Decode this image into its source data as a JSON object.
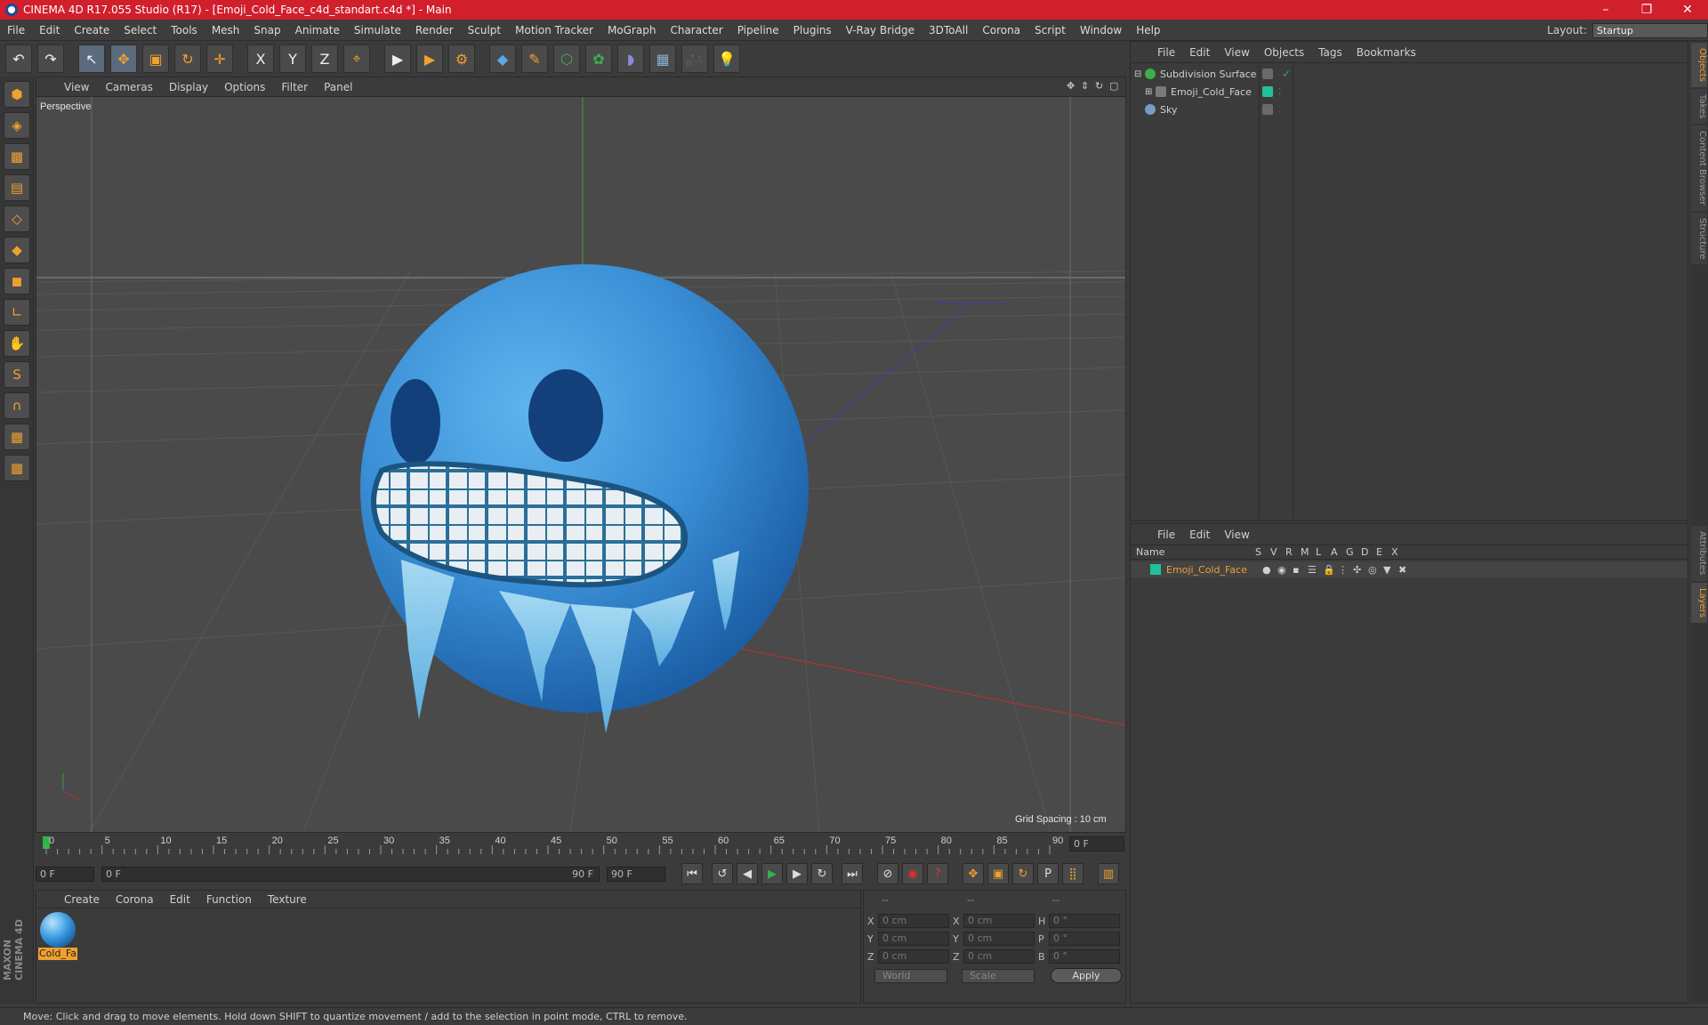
{
  "window": {
    "title": "CINEMA 4D R17.055 Studio (R17) - [Emoji_Cold_Face_c4d_standart.c4d *] - Main",
    "minimize": "–",
    "maximize": "❐",
    "close": "✕"
  },
  "menu": [
    "File",
    "Edit",
    "Create",
    "Select",
    "Tools",
    "Mesh",
    "Snap",
    "Animate",
    "Simulate",
    "Render",
    "Sculpt",
    "Motion Tracker",
    "MoGraph",
    "Character",
    "Pipeline",
    "Plugins",
    "V-Ray Bridge",
    "3DToAll",
    "Corona",
    "Script",
    "Window",
    "Help"
  ],
  "layout": {
    "label": "Layout:",
    "value": "Startup"
  },
  "toolbar": {
    "undo": "↶",
    "redo": "↷",
    "select": "↖",
    "move": "✥",
    "scale": "▣",
    "rotate": "↻",
    "transform": "✛",
    "x": "X",
    "y": "Y",
    "z": "Z",
    "coord": "⌖",
    "render": "▶",
    "render_view": "▶",
    "render_settings": "⚙",
    "cube": "◆",
    "pen": "✎",
    "subdiv": "⬡",
    "array": "✿",
    "deformer": "◗",
    "floor": "▦",
    "camera": "🎥",
    "light": "💡"
  },
  "viewport": {
    "menu": [
      "View",
      "Cameras",
      "Display",
      "Options",
      "Filter",
      "Panel"
    ],
    "label": "Perspective",
    "grid_spacing": "Grid Spacing : 10 cm"
  },
  "timeline": {
    "ticks": [
      "0",
      "5",
      "10",
      "15",
      "20",
      "25",
      "30",
      "35",
      "40",
      "45",
      "50",
      "55",
      "60",
      "65",
      "70",
      "75",
      "80",
      "85",
      "90"
    ],
    "current": "0 F",
    "start": "0 F",
    "range_start": "0 F",
    "range_end": "90 F",
    "end": "90 F"
  },
  "material_panel": {
    "menu": [
      "Create",
      "Corona",
      "Edit",
      "Function",
      "Texture"
    ],
    "material_name": "Cold_Fa"
  },
  "coords": {
    "header": [
      "--",
      "--",
      "--"
    ],
    "rows": [
      {
        "a1": "X",
        "v1": "0 cm",
        "a2": "X",
        "v2": "0 cm",
        "a3": "H",
        "v3": "0 °"
      },
      {
        "a1": "Y",
        "v1": "0 cm",
        "a2": "Y",
        "v2": "0 cm",
        "a3": "P",
        "v3": "0 °"
      },
      {
        "a1": "Z",
        "v1": "0 cm",
        "a2": "Z",
        "v2": "0 cm",
        "a3": "B",
        "v3": "0 °"
      }
    ],
    "space": "World",
    "mode": "Scale",
    "apply": "Apply"
  },
  "object_manager": {
    "menu": [
      "File",
      "Edit",
      "View",
      "Objects",
      "Tags",
      "Bookmarks"
    ],
    "objects": [
      {
        "name": "Subdivision Surface",
        "color": "#3bb04a"
      },
      {
        "name": "Emoji_Cold_Face",
        "color": "#1fc29a"
      },
      {
        "name": "Sky",
        "color": "#7a9ac8"
      }
    ]
  },
  "layer_manager": {
    "menu": [
      "File",
      "Edit",
      "View"
    ],
    "columns": [
      "Name",
      "S",
      "V",
      "R",
      "M",
      "L",
      "A",
      "G",
      "D",
      "E",
      "X"
    ],
    "layer": "Emoji_Cold_Face",
    "layer_color": "#1fc29a"
  },
  "side_tabs": [
    "Objects",
    "Takes",
    "Content Browser",
    "Structure",
    "Attributes",
    "Layers"
  ],
  "maxon": "MAXON CINEMA 4D",
  "status": "Move: Click and drag to move elements. Hold down SHIFT to quantize movement / add to the selection in point mode, CTRL to remove."
}
